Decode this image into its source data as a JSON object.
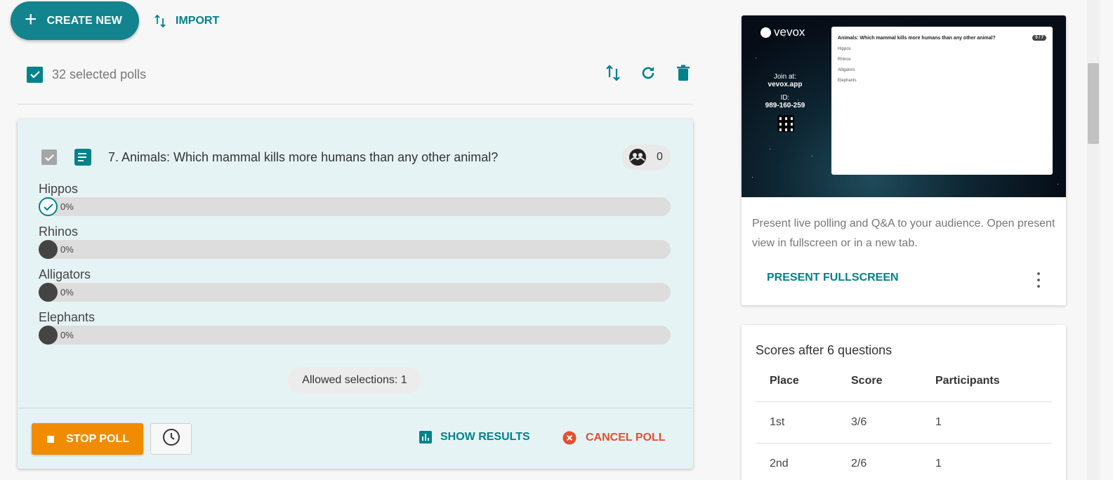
{
  "toolbar": {
    "create_label": "CREATE NEW",
    "import_label": "IMPORT"
  },
  "selection": {
    "label": "32 selected polls"
  },
  "poll": {
    "title": "7. Animals: Which mammal kills more humans than any other animal?",
    "participant_count": "0",
    "options": [
      {
        "name": "Hippos",
        "percent": "0%",
        "correct": true
      },
      {
        "name": "Rhinos",
        "percent": "0%",
        "correct": false
      },
      {
        "name": "Alligators",
        "percent": "0%",
        "correct": false
      },
      {
        "name": "Elephants",
        "percent": "0%",
        "correct": false
      }
    ],
    "allowed_selections": "Allowed selections: 1",
    "stop_label": "STOP POLL",
    "show_results_label": "SHOW RESULTS",
    "cancel_label": "CANCEL POLL"
  },
  "preview": {
    "logo": "vevox",
    "join_at": "Join at:",
    "join_url": "vevox.app",
    "id_label": "ID:",
    "id_value": "989-160-259",
    "slide_question": "Animals: Which mammal kills more humans than any other animal?",
    "slide_count": "0 / 7",
    "slide_options": [
      "Hippos",
      "Rhinos",
      "Alligators",
      "Elephants"
    ]
  },
  "present": {
    "description": "Present live polling and Q&A to your audience. Open present view in fullscreen or in a new tab.",
    "fullscreen_label": "PRESENT FULLSCREEN"
  },
  "scores": {
    "title": "Scores after 6 questions",
    "headers": [
      "Place",
      "Score",
      "Participants"
    ],
    "rows": [
      [
        "1st",
        "3/6",
        "1"
      ],
      [
        "2nd",
        "2/6",
        "1"
      ]
    ]
  },
  "colors": {
    "accent": "#00828b",
    "stop": "#f08c00",
    "cancel": "#e2502e",
    "poll_bg": "#e6f3f5"
  }
}
